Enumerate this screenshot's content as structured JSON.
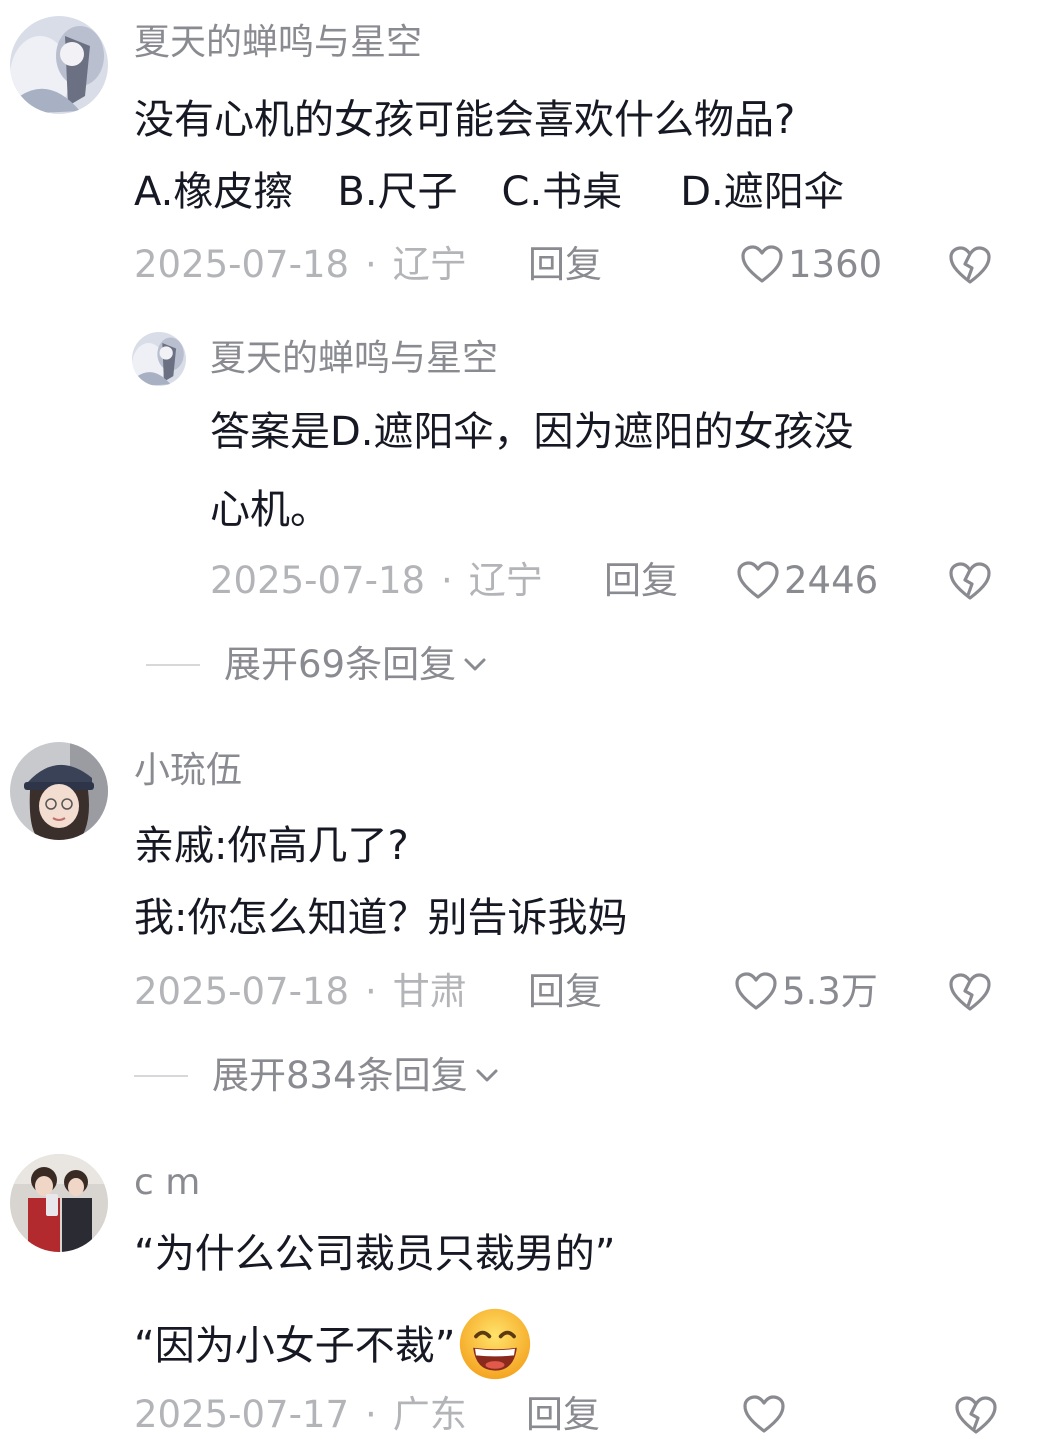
{
  "comments": [
    {
      "username": "夏天的蝉鸣与星空",
      "lines": [
        "没有心机的女孩可能会喜欢什么物品?"
      ],
      "options": [
        "A.橡皮擦",
        "B.尺子",
        "C.书桌",
        "D.遮阳伞"
      ],
      "date": "2025-07-18",
      "location": "辽宁",
      "reply_label": "回复",
      "likes": "1360",
      "reply": {
        "username": "夏天的蝉鸣与星空",
        "lines": [
          "答案是D.遮阳伞，因为遮阳的女孩没",
          "心机。"
        ],
        "date": "2025-07-18",
        "location": "辽宁",
        "reply_label": "回复",
        "likes": "2446"
      },
      "expand_label": "展开69条回复"
    },
    {
      "username": "小琉伍",
      "lines": [
        "亲戚:你高几了?",
        "我:你怎么知道？别告诉我妈"
      ],
      "date": "2025-07-18",
      "location": "甘肃",
      "reply_label": "回复",
      "likes": "5.3万",
      "expand_label": "展开834条回复"
    },
    {
      "username": "c m",
      "lines": [
        "“为什么公司裁员只裁男的”",
        "“因为小女子不裁”"
      ],
      "emoji": "grinning-face-emoji",
      "date": "2025-07-17",
      "location": "广东",
      "reply_label": "回复",
      "likes": ""
    }
  ],
  "separator": "·",
  "colors": {
    "username": "#8a8b91",
    "text": "#161823",
    "meta": "#b3b4b8"
  }
}
